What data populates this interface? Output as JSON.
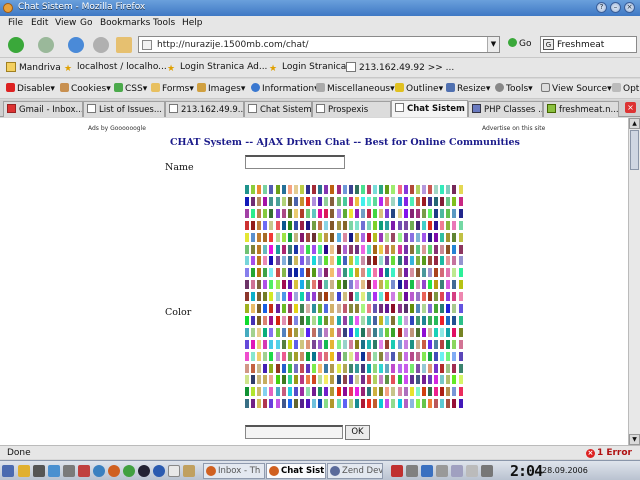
{
  "window": {
    "title": "Chat Sistem - Mozilla Firefox"
  },
  "menu": [
    "File",
    "Edit",
    "View",
    "Go",
    "Bookmarks",
    "Tools",
    "Help"
  ],
  "nav": {
    "url": "http://nurazije.1500mb.com/chat/",
    "go_label": "Go",
    "search_value": "Freshmeat"
  },
  "bookmarks": [
    "Mandriva",
    "localhost / localho...",
    "Login Stranica Ad...",
    "Login Stranica",
    "213.162.49.92 >> ..."
  ],
  "devtools": [
    "Disable",
    "Cookies",
    "CSS",
    "Forms",
    "Images",
    "Information",
    "Miscellaneous",
    "Outline",
    "Resize",
    "Tools",
    "View Source",
    "Opt"
  ],
  "tabs": [
    {
      "label": "Gmail - Inbox...",
      "active": false
    },
    {
      "label": "List of Issues...",
      "active": false
    },
    {
      "label": "213.162.49.9...",
      "active": false
    },
    {
      "label": "Chat Sistem",
      "active": false
    },
    {
      "label": "Prospexis",
      "active": false
    },
    {
      "label": "Chat Sistem",
      "active": true
    },
    {
      "label": "PHP Classes ...",
      "active": false
    },
    {
      "label": "freshmeat.n...",
      "active": false
    }
  ],
  "page": {
    "ads_left": "Ads by Goooooogle",
    "ads_right": "Advertise on this site",
    "heading": "CHAT System -- AJAX Driven Chat -- Best for Online Communities",
    "name_label": "Name",
    "color_label": "Color",
    "ok_label": "OK"
  },
  "status": {
    "text": "Done",
    "errors": "1 Error"
  },
  "taskbar": {
    "tasks": [
      {
        "label": "Inbox - Th",
        "active": false
      },
      {
        "label": "Chat Sist",
        "active": true
      },
      {
        "label": "Zend Dev",
        "active": false
      }
    ],
    "time": "2:04",
    "date": "28.09.2006"
  },
  "colors": {
    "title_bar": "#3f78c4",
    "heading": "#1a1a8a",
    "error": "#b01010"
  }
}
